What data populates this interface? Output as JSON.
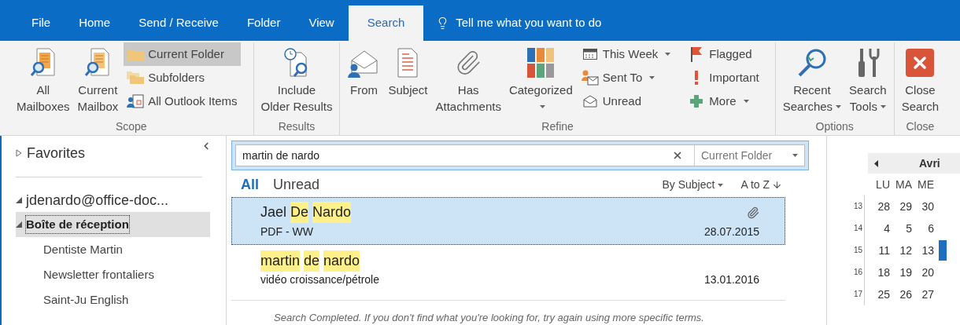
{
  "tabs": [
    {
      "label": "File",
      "selected": false
    },
    {
      "label": "Home",
      "selected": false
    },
    {
      "label": "Send / Receive",
      "selected": false
    },
    {
      "label": "Folder",
      "selected": false
    },
    {
      "label": "View",
      "selected": false
    },
    {
      "label": "Search",
      "selected": true
    }
  ],
  "tell_me": {
    "placeholder": "Tell me what you want to do"
  },
  "ribbon": {
    "groups": [
      {
        "label": "Scope",
        "buttons": [
          {
            "kind": "large",
            "lines": [
              "All",
              "Mailboxes"
            ],
            "dropdown": false,
            "selected": false
          },
          {
            "kind": "large",
            "lines": [
              "Current",
              "Mailbox"
            ],
            "dropdown": false,
            "selected": false
          },
          {
            "kind": "small",
            "lines": [
              "Current Folder"
            ],
            "dropdown": false,
            "selected": true
          },
          {
            "kind": "small",
            "lines": [
              "Subfolders"
            ],
            "dropdown": false,
            "selected": false
          },
          {
            "kind": "small",
            "lines": [
              "All Outlook Items"
            ],
            "dropdown": false,
            "selected": false
          }
        ]
      },
      {
        "label": "Results",
        "buttons": [
          {
            "kind": "large",
            "lines": [
              "Include",
              "Older Results"
            ],
            "dropdown": false,
            "selected": false
          }
        ]
      },
      {
        "label": "Refine",
        "buttons": [
          {
            "kind": "large",
            "lines": [
              "From"
            ],
            "dropdown": false,
            "selected": false
          },
          {
            "kind": "large",
            "lines": [
              "Subject"
            ],
            "dropdown": false,
            "selected": false
          },
          {
            "kind": "large",
            "lines": [
              "Has",
              "Attachments"
            ],
            "dropdown": false,
            "selected": false
          },
          {
            "kind": "large",
            "lines": [
              "Categorized"
            ],
            "dropdown": true,
            "selected": false
          },
          {
            "kind": "small",
            "lines": [
              "This Week"
            ],
            "dropdown": true,
            "selected": false
          },
          {
            "kind": "small",
            "lines": [
              "Sent To"
            ],
            "dropdown": true,
            "selected": false
          },
          {
            "kind": "small",
            "lines": [
              "Unread"
            ],
            "dropdown": false,
            "selected": false
          },
          {
            "kind": "small",
            "lines": [
              "Flagged"
            ],
            "dropdown": false,
            "selected": false
          },
          {
            "kind": "small",
            "lines": [
              "Important"
            ],
            "dropdown": false,
            "selected": false
          },
          {
            "kind": "small",
            "lines": [
              "More"
            ],
            "dropdown": true,
            "selected": false
          }
        ]
      },
      {
        "label": "Options",
        "buttons": [
          {
            "kind": "large",
            "lines": [
              "Recent",
              "Searches"
            ],
            "dropdown": true,
            "selected": false
          },
          {
            "kind": "large",
            "lines": [
              "Search",
              "Tools"
            ],
            "dropdown": true,
            "selected": false
          }
        ]
      },
      {
        "label": "Close",
        "buttons": [
          {
            "kind": "large",
            "lines": [
              "Close",
              "Search"
            ],
            "dropdown": false,
            "selected": false
          }
        ]
      }
    ]
  },
  "folder_pane": {
    "favorites": {
      "label": "Favorites",
      "expanded": false
    },
    "accounts": [
      {
        "label": "jdenardo@office-doc...",
        "expanded": true,
        "children": [
          {
            "label": "Boîte de réception",
            "expanded": true,
            "selected": true,
            "children": [
              {
                "label": "Dentiste Martin",
                "selected": false
              },
              {
                "label": "Newsletter frontaliers",
                "selected": false
              },
              {
                "label": "Saint-Ju English",
                "selected": false
              }
            ]
          }
        ]
      }
    ]
  },
  "search": {
    "value": "martin de nardo",
    "scope": "Current Folder"
  },
  "filters": [
    {
      "label": "All",
      "selected": true
    },
    {
      "label": "Unread",
      "selected": false
    }
  ],
  "sort": {
    "arrange": "By Subject",
    "order": "A to Z"
  },
  "messages": [
    {
      "from": [
        {
          "text": "Jael",
          "highlighted": false
        },
        {
          "text": "De",
          "highlighted": true
        },
        {
          "text": "Nardo",
          "highlighted": true
        }
      ],
      "subject": "PDF - WW",
      "date": "28.07.2015",
      "attachment": true,
      "selected": true
    },
    {
      "from": [
        {
          "text": "martin",
          "highlighted": true
        },
        {
          "text": "de",
          "highlighted": true
        },
        {
          "text": "nardo",
          "highlighted": true
        }
      ],
      "subject": "vidéo croissance/pétrole",
      "date": "13.01.2016",
      "attachment": false,
      "selected": false
    }
  ],
  "status_message": "Search Completed. If you don't find what you're looking for, try again using more specific terms.",
  "calendar": {
    "month": "Avri",
    "weekdays": [
      "LU",
      "MA",
      "ME"
    ],
    "weeks": [
      {
        "number": "13",
        "days": [
          "28",
          "29",
          "30"
        ],
        "selected": false
      },
      {
        "number": "14",
        "days": [
          "4",
          "5",
          "6"
        ],
        "selected": false
      },
      {
        "number": "15",
        "days": [
          "11",
          "12",
          "13"
        ],
        "selected": true
      },
      {
        "number": "16",
        "days": [
          "18",
          "19",
          "20"
        ],
        "selected": false
      },
      {
        "number": "17",
        "days": [
          "25",
          "26",
          "27"
        ],
        "selected": false
      }
    ]
  }
}
